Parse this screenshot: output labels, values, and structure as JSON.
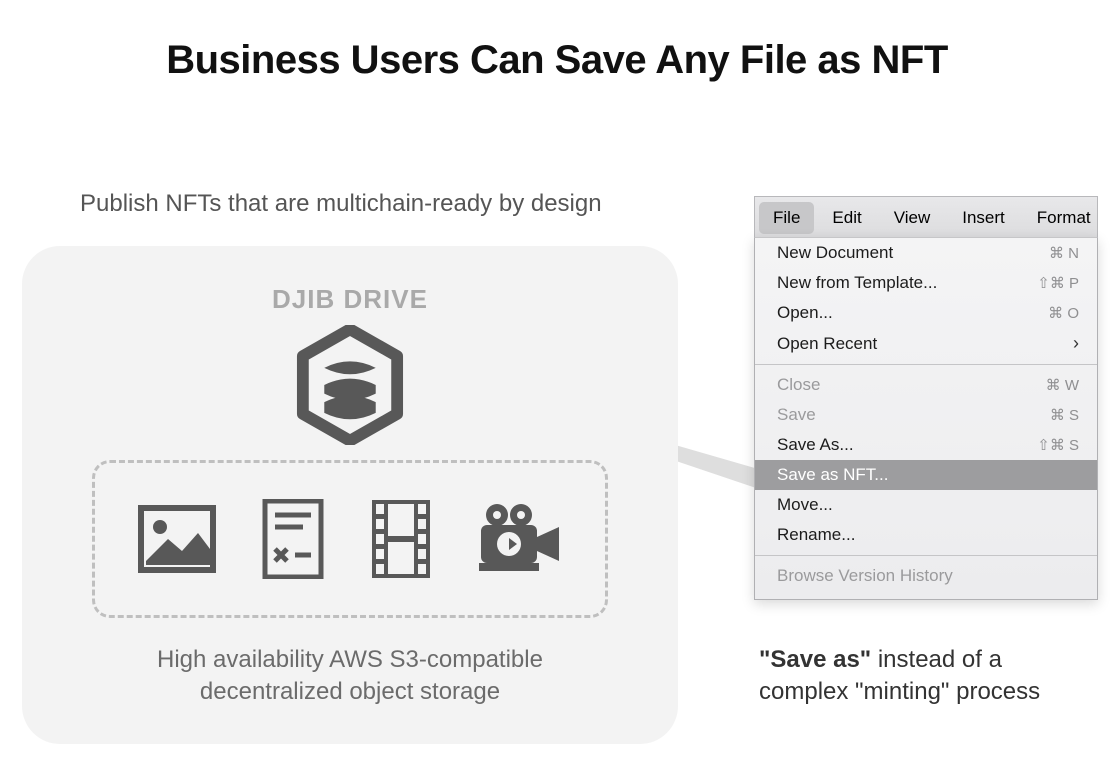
{
  "title": "Business Users Can Save Any File as NFT",
  "subtitle": "Publish NFTs that are multichain-ready by design",
  "drive": {
    "label": "DJIB DRIVE",
    "desc_line1": "High availability AWS S3-compatible",
    "desc_line2": "decentralized object storage",
    "icons": [
      "image-icon",
      "document-icon",
      "film-icon",
      "camera-icon"
    ]
  },
  "menubar": {
    "items": [
      "File",
      "Edit",
      "View",
      "Insert",
      "Format"
    ],
    "active": "File"
  },
  "dropdown": {
    "items": [
      {
        "label": "New Document",
        "shortcut": "⌘ N"
      },
      {
        "label": "New from Template...",
        "shortcut": "⇧⌘ P"
      },
      {
        "label": "Open...",
        "shortcut": "⌘ O"
      },
      {
        "label": "Open Recent",
        "chevron": true
      },
      {
        "sep": true
      },
      {
        "label": "Close",
        "shortcut": "⌘ W",
        "disabled": true
      },
      {
        "label": "Save",
        "shortcut": "⌘ S",
        "disabled": true
      },
      {
        "label": "Save As...",
        "shortcut": "⇧⌘ S"
      },
      {
        "label": "Save as NFT...",
        "highlight": true
      },
      {
        "label": "Move..."
      },
      {
        "label": "Rename..."
      },
      {
        "sep": true
      },
      {
        "label": "Browse Version History",
        "disabled": true
      }
    ]
  },
  "caption": {
    "bold": "\"Save as\"",
    "rest": " instead of a complex \"minting\" process"
  }
}
